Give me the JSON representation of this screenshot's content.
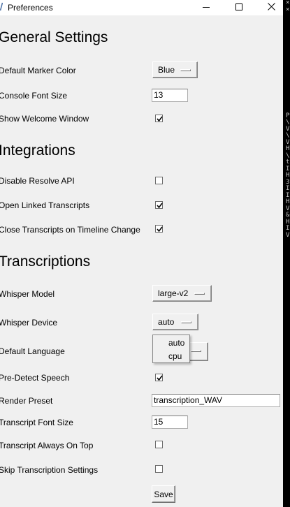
{
  "window": {
    "title": "Preferences"
  },
  "sections": {
    "general": "General Settings",
    "integrations": "Integrations",
    "transcriptions": "Transcriptions"
  },
  "fields": {
    "default_marker_color": {
      "label": "Default Marker Color",
      "value": "Blue"
    },
    "console_font_size": {
      "label": "Console Font Size",
      "value": "13"
    },
    "show_welcome_window": {
      "label": "Show Welcome Window",
      "checked": true
    },
    "disable_resolve_api": {
      "label": "Disable Resolve API",
      "checked": false
    },
    "open_linked_transcripts": {
      "label": "Open Linked Transcripts",
      "checked": true
    },
    "close_transcripts_on_timeline_change": {
      "label": "Close Transcripts on Timeline Change",
      "checked": true
    },
    "whisper_model": {
      "label": "Whisper Model",
      "value": "large-v2"
    },
    "whisper_device": {
      "label": "Whisper Device",
      "value": "auto",
      "options": [
        "auto",
        "cpu"
      ]
    },
    "default_language": {
      "label": "Default Language"
    },
    "pre_detect_speech": {
      "label": "Pre-Detect Speech",
      "checked": true
    },
    "render_preset": {
      "label": "Render Preset",
      "value": "transcription_WAV"
    },
    "transcript_font_size": {
      "label": "Transcript Font Size",
      "value": "15"
    },
    "transcript_always_on_top": {
      "label": "Transcript Always On Top",
      "checked": false
    },
    "skip_transcription_settings": {
      "label": "Skip Transcription Settings",
      "checked": false
    }
  },
  "buttons": {
    "save": "Save"
  },
  "side_text": "×\n×\n\n\n\n\n\n\n\n\n\n\n\n\n\n\n\nP\n\\\nV\n\\\nV\nH\n\\\nt\nI\nH\n3\nI\nI\nH\nV\n&\nH\nI\nV"
}
